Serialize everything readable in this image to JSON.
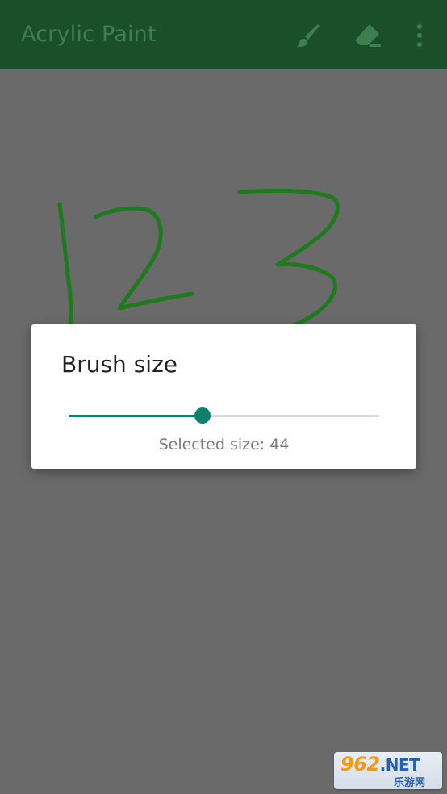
{
  "app_bar": {
    "title": "Acrylic Paint",
    "actions": [
      {
        "name": "brush-icon"
      },
      {
        "name": "eraser-icon"
      },
      {
        "name": "more-vert-icon"
      }
    ]
  },
  "dialog": {
    "title": "Brush size",
    "slider_value_fraction": 0.43,
    "selected_size_text": "Selected size: 44"
  },
  "watermark": {
    "main": "962",
    "suffix": ".NET",
    "sub": "乐游网"
  },
  "colors": {
    "app_bar": "#1b4f2b",
    "app_title": "#3e7f51",
    "canvas_scrim": "#6a6a6a",
    "stroke": "#1d7a1d",
    "accent": "#0f7f6e"
  }
}
